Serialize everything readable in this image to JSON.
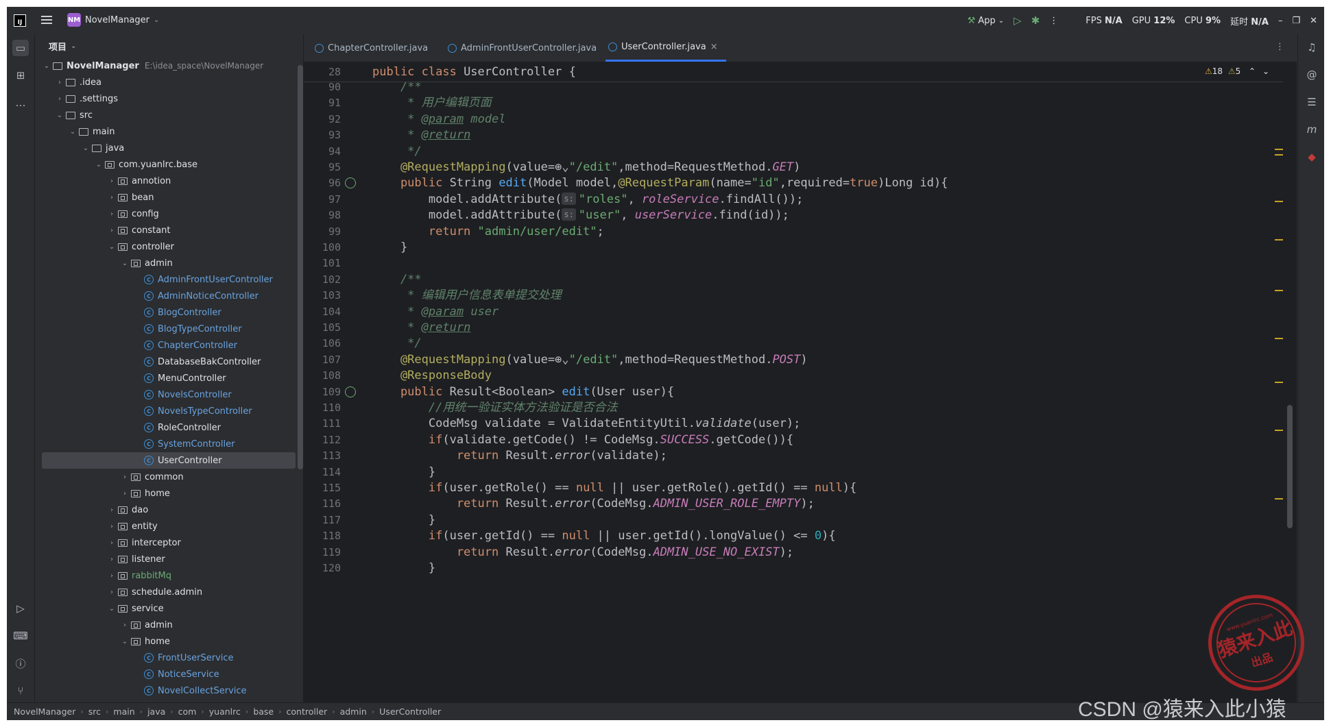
{
  "titlebar": {
    "logo": "IJ",
    "project_badge": "NM",
    "project_name": "NovelManager",
    "run_config": "App",
    "fps_label": "FPS",
    "fps_value": "N/A",
    "gpu_label": "GPU",
    "gpu_value": "12%",
    "cpu_label": "CPU",
    "cpu_value": "9%",
    "latency_label": "延时",
    "latency_value": "N/A"
  },
  "project_panel": {
    "title": "项目",
    "tree": [
      {
        "label": "NovelManager",
        "path": "E:\\idea_space\\NovelManager",
        "depth": 0,
        "open": true,
        "kind": "module"
      },
      {
        "label": ".idea",
        "depth": 1,
        "open": false,
        "kind": "folder"
      },
      {
        "label": ".settings",
        "depth": 1,
        "open": false,
        "kind": "folder"
      },
      {
        "label": "src",
        "depth": 1,
        "open": true,
        "kind": "folder"
      },
      {
        "label": "main",
        "depth": 2,
        "open": true,
        "kind": "folder"
      },
      {
        "label": "java",
        "depth": 3,
        "open": true,
        "kind": "folder"
      },
      {
        "label": "com.yuanlrc.base",
        "depth": 4,
        "open": true,
        "kind": "package"
      },
      {
        "label": "annotion",
        "depth": 5,
        "open": false,
        "kind": "package"
      },
      {
        "label": "bean",
        "depth": 5,
        "open": false,
        "kind": "package"
      },
      {
        "label": "config",
        "depth": 5,
        "open": false,
        "kind": "package"
      },
      {
        "label": "constant",
        "depth": 5,
        "open": false,
        "kind": "package"
      },
      {
        "label": "controller",
        "depth": 5,
        "open": true,
        "kind": "package"
      },
      {
        "label": "admin",
        "depth": 6,
        "open": true,
        "kind": "package"
      },
      {
        "label": "AdminFrontUserController",
        "depth": 7,
        "kind": "class"
      },
      {
        "label": "AdminNoticeController",
        "depth": 7,
        "kind": "class"
      },
      {
        "label": "BlogController",
        "depth": 7,
        "kind": "class"
      },
      {
        "label": "BlogTypeController",
        "depth": 7,
        "kind": "class"
      },
      {
        "label": "ChapterController",
        "depth": 7,
        "kind": "class"
      },
      {
        "label": "DatabaseBakController",
        "depth": 7,
        "kind": "class-white"
      },
      {
        "label": "MenuController",
        "depth": 7,
        "kind": "class-white"
      },
      {
        "label": "NovelsController",
        "depth": 7,
        "kind": "class"
      },
      {
        "label": "NovelsTypeController",
        "depth": 7,
        "kind": "class"
      },
      {
        "label": "RoleController",
        "depth": 7,
        "kind": "class-white"
      },
      {
        "label": "SystemController",
        "depth": 7,
        "kind": "class"
      },
      {
        "label": "UserController",
        "depth": 7,
        "kind": "class-white",
        "selected": true
      },
      {
        "label": "common",
        "depth": 6,
        "open": false,
        "kind": "package"
      },
      {
        "label": "home",
        "depth": 6,
        "open": false,
        "kind": "package"
      },
      {
        "label": "dao",
        "depth": 5,
        "open": false,
        "kind": "package"
      },
      {
        "label": "entity",
        "depth": 5,
        "open": false,
        "kind": "package"
      },
      {
        "label": "interceptor",
        "depth": 5,
        "open": false,
        "kind": "package"
      },
      {
        "label": "listener",
        "depth": 5,
        "open": false,
        "kind": "package"
      },
      {
        "label": "rabbitMq",
        "depth": 5,
        "open": false,
        "kind": "package-green"
      },
      {
        "label": "schedule.admin",
        "depth": 5,
        "open": false,
        "kind": "package"
      },
      {
        "label": "service",
        "depth": 5,
        "open": true,
        "kind": "package"
      },
      {
        "label": "admin",
        "depth": 6,
        "open": false,
        "kind": "package"
      },
      {
        "label": "home",
        "depth": 6,
        "open": true,
        "kind": "package"
      },
      {
        "label": "FrontUserService",
        "depth": 7,
        "kind": "class"
      },
      {
        "label": "NoticeService",
        "depth": 7,
        "kind": "class"
      },
      {
        "label": "NovelCollectService",
        "depth": 7,
        "kind": "class"
      }
    ]
  },
  "tabs": [
    {
      "label": "ChapterController.java",
      "active": false
    },
    {
      "label": "AdminFrontUserController.java",
      "active": false
    },
    {
      "label": "UserController.java",
      "active": true,
      "close": "×"
    }
  ],
  "editor": {
    "inspection_warn": "18",
    "inspection_weak": "5",
    "sticky": {
      "num": "28",
      "tokens": [
        [
          "k",
          "public class "
        ],
        [
          "p",
          "UserController {"
        ]
      ]
    },
    "lines": [
      {
        "num": "90",
        "tokens": [
          [
            "c",
            "    /**"
          ]
        ]
      },
      {
        "num": "91",
        "tokens": [
          [
            "c",
            "     * 用户编辑页面"
          ]
        ]
      },
      {
        "num": "92",
        "tokens": [
          [
            "c",
            "     * "
          ],
          [
            "ct",
            "@param"
          ],
          [
            "c",
            " "
          ],
          [
            "c",
            "model"
          ]
        ]
      },
      {
        "num": "93",
        "tokens": [
          [
            "c",
            "     * "
          ],
          [
            "ct",
            "@return"
          ]
        ]
      },
      {
        "num": "94",
        "tokens": [
          [
            "c",
            "     */"
          ]
        ]
      },
      {
        "num": "95",
        "tokens": [
          [
            "a",
            "    @RequestMapping"
          ],
          [
            "p",
            "(value="
          ],
          [
            "p",
            "⊕⌄"
          ],
          [
            "s",
            "\"/edit\""
          ],
          [
            "p",
            ",method=RequestMethod."
          ],
          [
            "i",
            "GET"
          ],
          [
            "p",
            ")"
          ]
        ]
      },
      {
        "num": "96",
        "mark": true,
        "tokens": [
          [
            "k",
            "    public "
          ],
          [
            "p",
            "String "
          ],
          [
            "f",
            "edit"
          ],
          [
            "p",
            "(Model model,"
          ],
          [
            "a",
            "@RequestParam"
          ],
          [
            "p",
            "(name="
          ],
          [
            "s",
            "\"id\""
          ],
          [
            "p",
            ",required="
          ],
          [
            "k",
            "true"
          ],
          [
            "p",
            ")Long id){"
          ]
        ]
      },
      {
        "num": "97",
        "tokens": [
          [
            "p",
            "        model.addAttribute("
          ],
          [
            "hint",
            "s:"
          ],
          [
            "s",
            "\"roles\""
          ],
          [
            "p",
            ", "
          ],
          [
            "i",
            "roleService"
          ],
          [
            "p",
            ".findAll());"
          ]
        ]
      },
      {
        "num": "98",
        "tokens": [
          [
            "p",
            "        model.addAttribute("
          ],
          [
            "hint",
            "s:"
          ],
          [
            "s",
            "\"user\""
          ],
          [
            "p",
            ", "
          ],
          [
            "i",
            "userService"
          ],
          [
            "p",
            ".find(id));"
          ]
        ]
      },
      {
        "num": "99",
        "tokens": [
          [
            "k",
            "        return "
          ],
          [
            "s",
            "\"admin/user/edit\""
          ],
          [
            "p",
            ";"
          ]
        ]
      },
      {
        "num": "100",
        "tokens": [
          [
            "p",
            "    }"
          ]
        ]
      },
      {
        "num": "101",
        "tokens": [
          [
            "p",
            ""
          ]
        ]
      },
      {
        "num": "102",
        "tokens": [
          [
            "c",
            "    /**"
          ]
        ]
      },
      {
        "num": "103",
        "tokens": [
          [
            "c",
            "     * 编辑用户信息表单提交处理"
          ]
        ]
      },
      {
        "num": "104",
        "tokens": [
          [
            "c",
            "     * "
          ],
          [
            "ct",
            "@param"
          ],
          [
            "c",
            " user"
          ]
        ]
      },
      {
        "num": "105",
        "tokens": [
          [
            "c",
            "     * "
          ],
          [
            "ct",
            "@return"
          ]
        ]
      },
      {
        "num": "106",
        "tokens": [
          [
            "c",
            "     */"
          ]
        ]
      },
      {
        "num": "107",
        "tokens": [
          [
            "a",
            "    @RequestMapping"
          ],
          [
            "p",
            "(value="
          ],
          [
            "p",
            "⊕⌄"
          ],
          [
            "s",
            "\"/edit\""
          ],
          [
            "p",
            ",method=RequestMethod."
          ],
          [
            "i",
            "POST"
          ],
          [
            "p",
            ")"
          ]
        ]
      },
      {
        "num": "108",
        "tokens": [
          [
            "a",
            "    @ResponseBody"
          ]
        ]
      },
      {
        "num": "109",
        "mark": true,
        "tokens": [
          [
            "k",
            "    public "
          ],
          [
            "p",
            "Result<Boolean> "
          ],
          [
            "f",
            "edit"
          ],
          [
            "p",
            "(User user){"
          ]
        ]
      },
      {
        "num": "110",
        "tokens": [
          [
            "c",
            "        //用统一验证实体方法验证是否合法"
          ]
        ]
      },
      {
        "num": "111",
        "tokens": [
          [
            "p",
            "        CodeMsg validate = ValidateEntityUtil."
          ],
          [
            "m",
            "validate"
          ],
          [
            "p",
            "(user);"
          ]
        ]
      },
      {
        "num": "112",
        "tokens": [
          [
            "k",
            "        if"
          ],
          [
            "p",
            "(validate.getCode() != CodeMsg."
          ],
          [
            "i",
            "SUCCESS"
          ],
          [
            "p",
            ".getCode()){"
          ]
        ]
      },
      {
        "num": "113",
        "tokens": [
          [
            "k",
            "            return "
          ],
          [
            "p",
            "Result."
          ],
          [
            "m",
            "error"
          ],
          [
            "p",
            "(validate);"
          ]
        ]
      },
      {
        "num": "114",
        "tokens": [
          [
            "p",
            "        }"
          ]
        ]
      },
      {
        "num": "115",
        "tokens": [
          [
            "k",
            "        if"
          ],
          [
            "p",
            "(user.getRole() == "
          ],
          [
            "k",
            "null"
          ],
          [
            "p",
            " || user.getRole().getId() == "
          ],
          [
            "k",
            "null"
          ],
          [
            "p",
            "){"
          ]
        ]
      },
      {
        "num": "116",
        "tokens": [
          [
            "k",
            "            return "
          ],
          [
            "p",
            "Result."
          ],
          [
            "m",
            "error"
          ],
          [
            "p",
            "(CodeMsg."
          ],
          [
            "i",
            "ADMIN_USER_ROLE_EMPTY"
          ],
          [
            "p",
            ");"
          ]
        ]
      },
      {
        "num": "117",
        "tokens": [
          [
            "p",
            "        }"
          ]
        ]
      },
      {
        "num": "118",
        "tokens": [
          [
            "k",
            "        if"
          ],
          [
            "p",
            "(user.getId() == "
          ],
          [
            "k",
            "null"
          ],
          [
            "p",
            " || user.getId().longValue() <= "
          ],
          [
            "n",
            "0"
          ],
          [
            "p",
            "){"
          ]
        ]
      },
      {
        "num": "119",
        "tokens": [
          [
            "k",
            "            return "
          ],
          [
            "p",
            "Result."
          ],
          [
            "m",
            "error"
          ],
          [
            "p",
            "(CodeMsg."
          ],
          [
            "i",
            "ADMIN_USE_NO_EXIST"
          ],
          [
            "p",
            ");"
          ]
        ]
      },
      {
        "num": "120",
        "tokens": [
          [
            "p",
            "        }"
          ]
        ]
      }
    ]
  },
  "statusbar": {
    "breadcrumb": [
      "NovelManager",
      "src",
      "main",
      "java",
      "com",
      "yuanlrc",
      "base",
      "controller",
      "admin",
      "UserController"
    ]
  },
  "watermark": {
    "seal_top": "www.yuanlrc.com",
    "seal_main": "猿来入此",
    "seal_bottom": "出品",
    "csdn": "CSDN @猿来入此小猿"
  },
  "colors": {
    "accent": "#3574f0",
    "editor_bg": "#1e1f22",
    "panel_bg": "#2b2d30",
    "seal_red": "#b3262a"
  }
}
